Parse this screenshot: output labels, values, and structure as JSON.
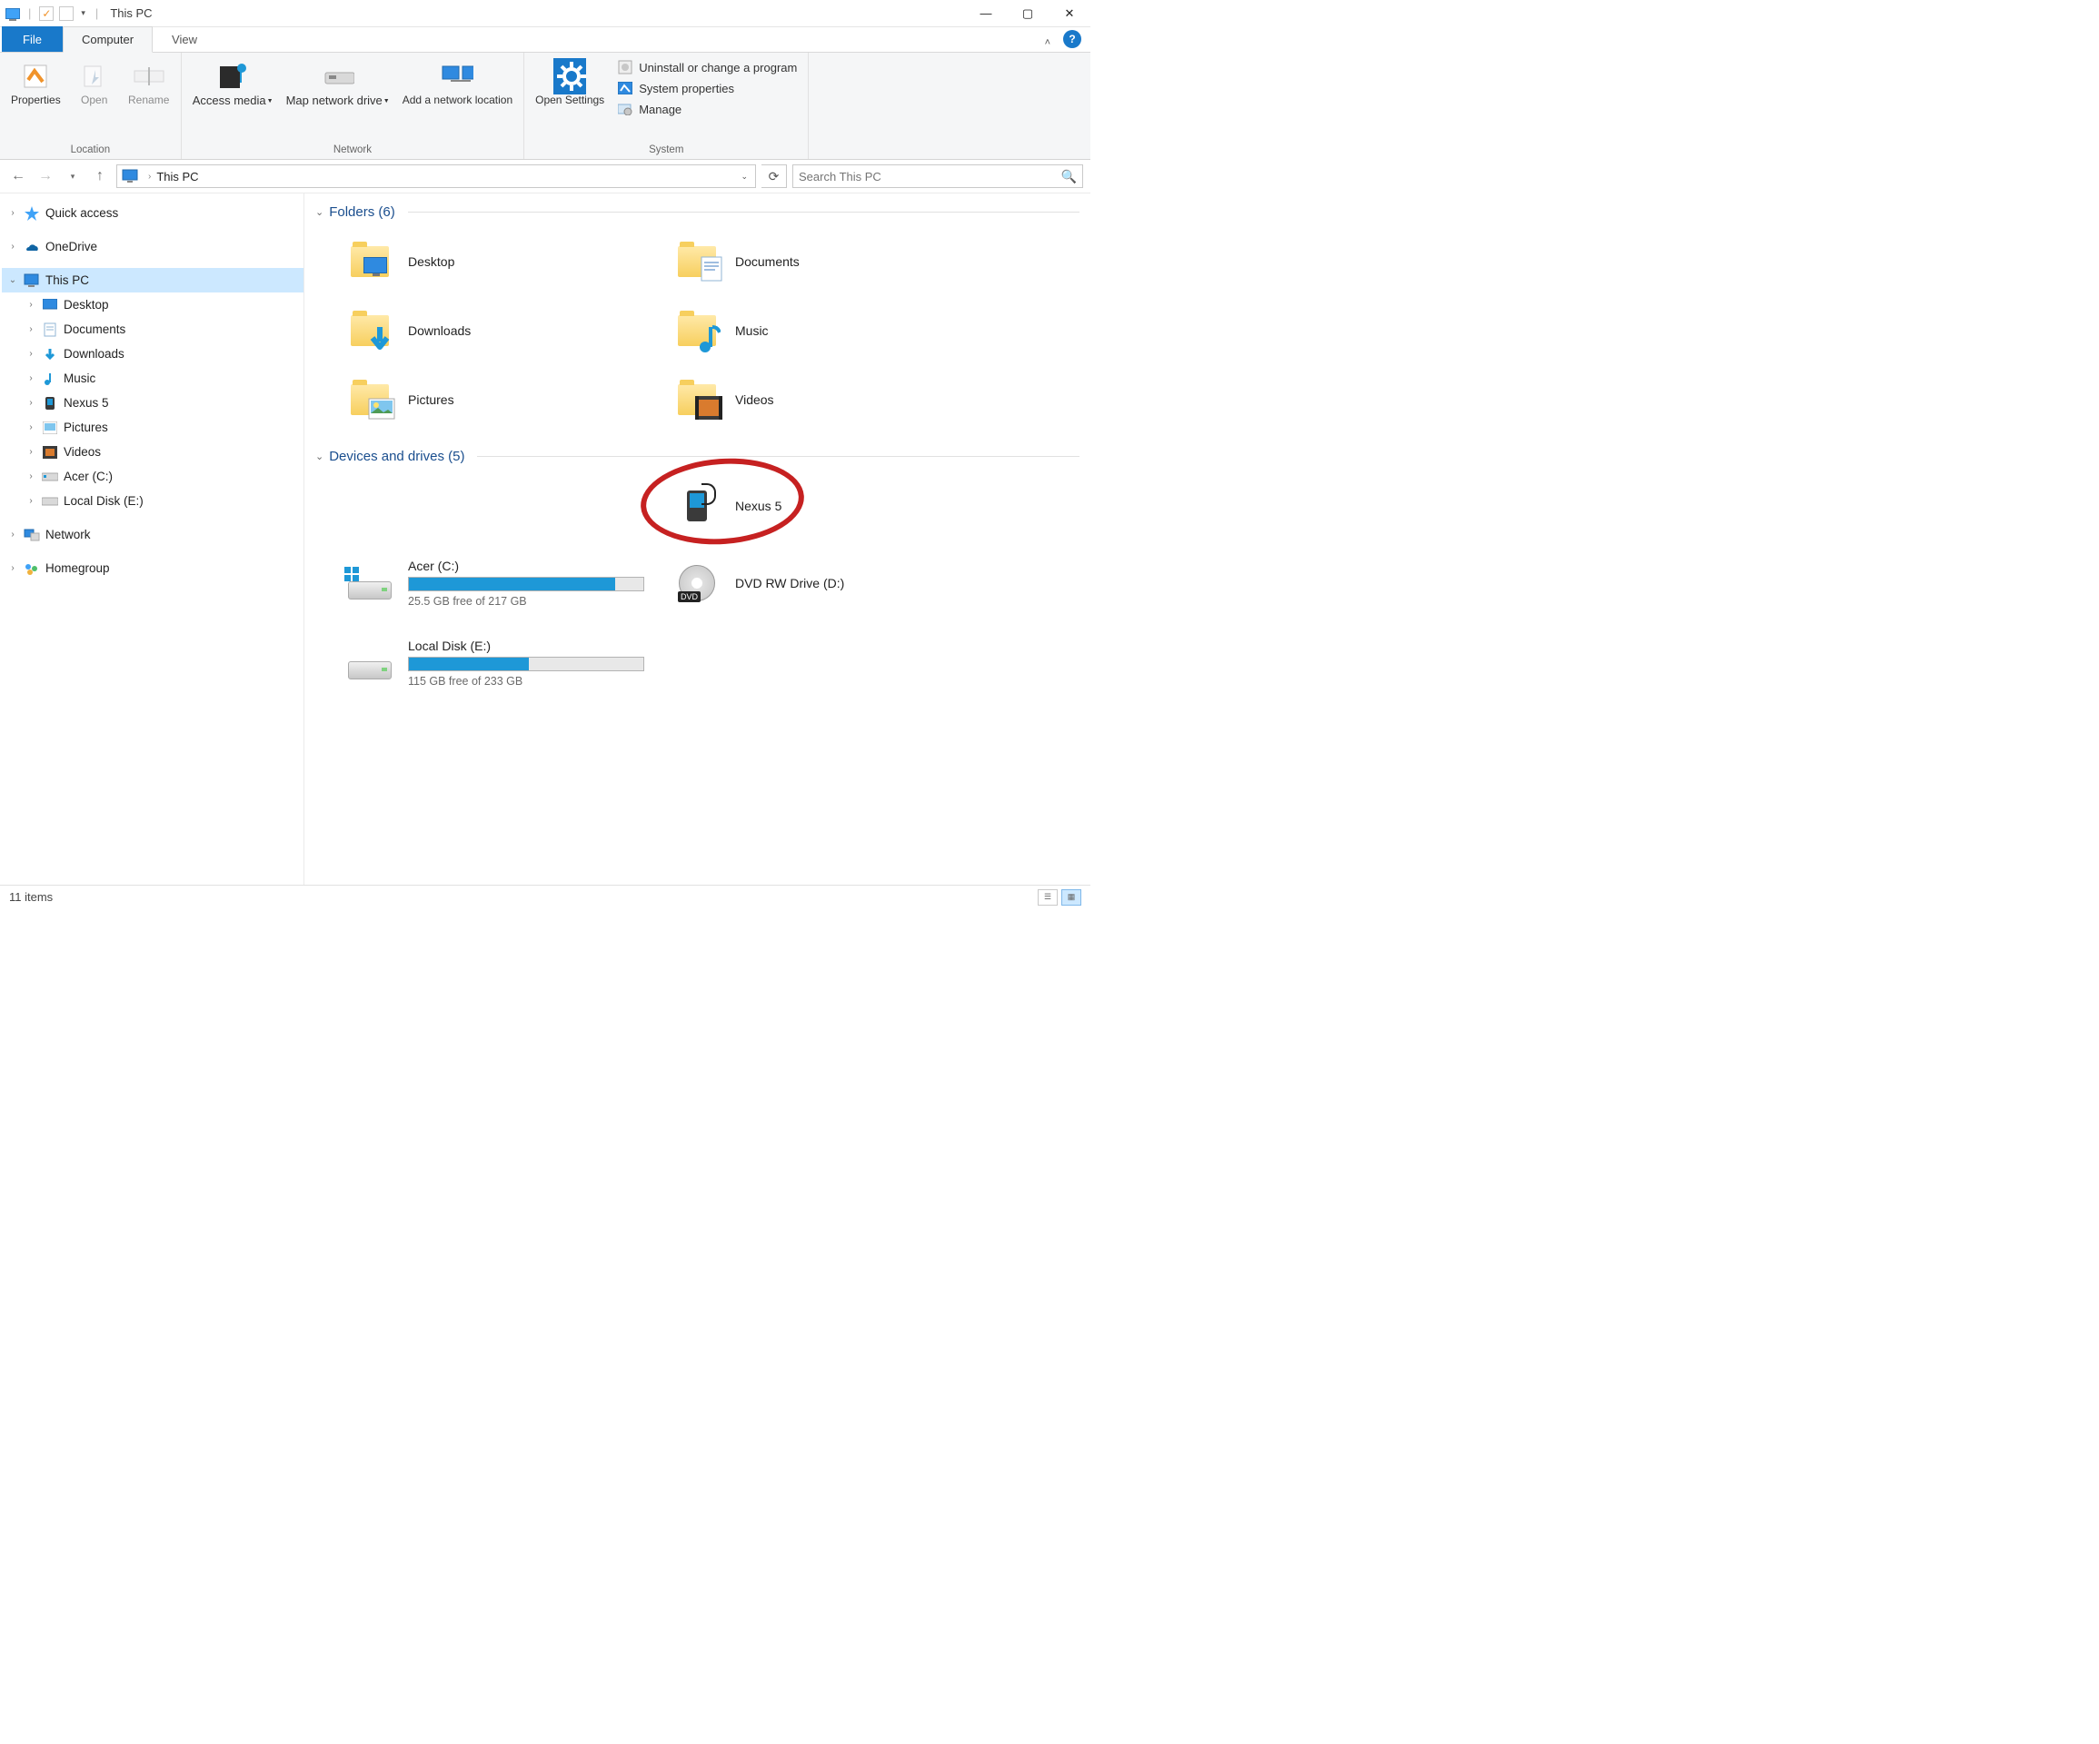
{
  "window": {
    "title": "This PC"
  },
  "tabs": {
    "file": "File",
    "computer": "Computer",
    "view": "View"
  },
  "ribbon": {
    "location": {
      "group": "Location",
      "properties": "Properties",
      "open": "Open",
      "rename": "Rename"
    },
    "network": {
      "group": "Network",
      "access_media": "Access media",
      "map_drive": "Map network drive",
      "add_location": "Add a network location"
    },
    "system": {
      "group": "System",
      "open_settings": "Open Settings",
      "uninstall": "Uninstall or change a program",
      "sys_props": "System properties",
      "manage": "Manage"
    }
  },
  "address": {
    "location": "This PC"
  },
  "search": {
    "placeholder": "Search This PC"
  },
  "nav": {
    "quick_access": "Quick access",
    "onedrive": "OneDrive",
    "this_pc": "This PC",
    "network": "Network",
    "homegroup": "Homegroup",
    "children": {
      "desktop": "Desktop",
      "documents": "Documents",
      "downloads": "Downloads",
      "music": "Music",
      "nexus5": "Nexus 5",
      "pictures": "Pictures",
      "videos": "Videos",
      "acer_c": "Acer (C:)",
      "local_e": "Local Disk (E:)"
    }
  },
  "groups": {
    "folders": {
      "title": "Folders (6)",
      "items": {
        "desktop": "Desktop",
        "documents": "Documents",
        "downloads": "Downloads",
        "music": "Music",
        "pictures": "Pictures",
        "videos": "Videos"
      }
    },
    "devices": {
      "title": "Devices and drives (5)",
      "nexus5": "Nexus 5",
      "acer": {
        "label": "Acer (C:)",
        "sub": "25.5 GB free of 217 GB",
        "fill_pct": 88
      },
      "dvd": "DVD RW Drive (D:)",
      "local_e": {
        "label": "Local Disk (E:)",
        "sub": "115 GB free of 233 GB",
        "fill_pct": 51
      }
    }
  },
  "status": {
    "items": "11 items"
  }
}
